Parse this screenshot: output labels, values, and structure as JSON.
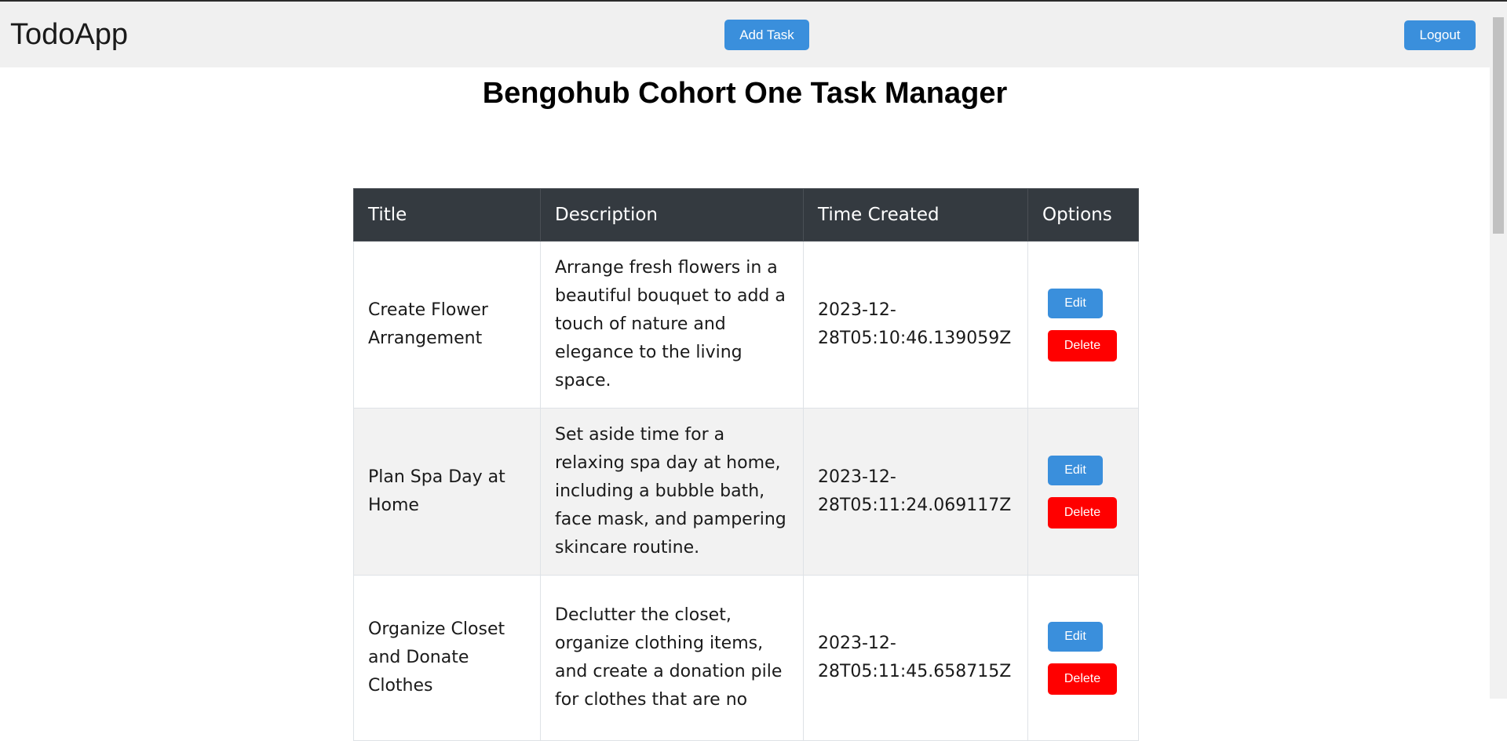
{
  "navbar": {
    "brand": "TodoApp",
    "add_task_label": "Add Task",
    "logout_label": "Logout"
  },
  "page": {
    "title": "Bengohub Cohort One Task Manager"
  },
  "table": {
    "headers": {
      "title": "Title",
      "description": "Description",
      "time_created": "Time Created",
      "options": "Options"
    },
    "rows": [
      {
        "title": "Create Flower Arrangement",
        "description": "Arrange fresh flowers in a beautiful bouquet to add a touch of nature and elegance to the living space.",
        "time_created": "2023-12-28T05:10:46.139059Z",
        "edit_label": "Edit",
        "delete_label": "Delete"
      },
      {
        "title": "Plan Spa Day at Home",
        "description": "Set aside time for a relaxing spa day at home, including a bubble bath, face mask, and pampering skincare routine.",
        "time_created": "2023-12-28T05:11:24.069117Z",
        "edit_label": "Edit",
        "delete_label": "Delete"
      },
      {
        "title": "Organize Closet and Donate Clothes",
        "description": "Declutter the closet, organize clothing items, and create a donation pile for clothes that are no",
        "time_created": "2023-12-28T05:11:45.658715Z",
        "edit_label": "Edit",
        "delete_label": "Delete"
      }
    ]
  },
  "colors": {
    "navbar_bg": "#f0f0f0",
    "button_blue": "#3a8fdc",
    "button_red": "#ff0000",
    "table_header_bg": "#343a40"
  }
}
